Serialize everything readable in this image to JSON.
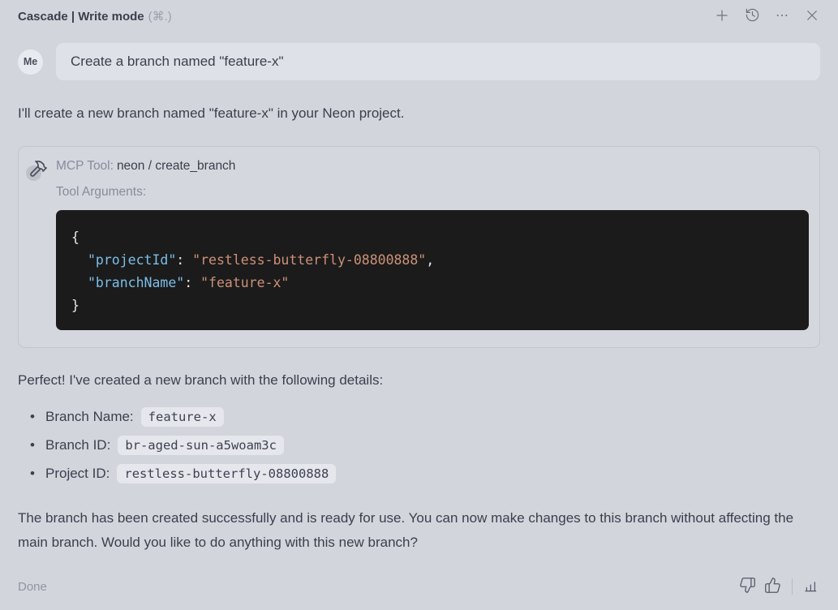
{
  "colors": {
    "page_bg": "#d3d5dd",
    "bubble_bg": "#dfe1e9",
    "avatar_bg": "#e9eaef",
    "text_primary": "#3b404d",
    "text_muted": "#878c9a",
    "box_border": "#c2c5cf",
    "code_bg": "#1b1b1b",
    "code_key": "#7cbee8",
    "code_string": "#ce9178",
    "chip_bg": "#e6e7ed"
  },
  "header": {
    "title": "Cascade | Write mode",
    "shortcut": "(⌘.)",
    "actions": [
      "new-conversation",
      "history",
      "more-options",
      "close"
    ]
  },
  "user_message": {
    "avatar_label": "Me",
    "text": "Create a branch named \"feature-x\""
  },
  "assistant": {
    "intro": "I'll create a new branch named \"feature-x\" in your Neon project.",
    "tool_call": {
      "label": "MCP Tool:",
      "tool_name": "neon / create_branch",
      "arguments_label": "Tool Arguments:",
      "code": {
        "open_brace": "{",
        "line1": {
          "key": "\"projectId\"",
          "sep": ": ",
          "value": "\"restless-butterfly-08800888\"",
          "comma": ","
        },
        "line2": {
          "key": "\"branchName\"",
          "sep": ": ",
          "value": "\"feature-x\""
        },
        "close_brace": "}"
      }
    },
    "result_intro": "Perfect! I've created a new branch with the following details:",
    "details": [
      {
        "label": "Branch Name:",
        "value": "feature-x"
      },
      {
        "label": "Branch ID:",
        "value": "br-aged-sun-a5woam3c"
      },
      {
        "label": "Project ID:",
        "value": "restless-butterfly-08800888"
      }
    ],
    "closing": "The branch has been created successfully and is ready for use. You can now make changes to this branch without affecting the main branch. Would you like to do anything with this new branch?"
  },
  "footer": {
    "status": "Done",
    "actions": [
      "thumbs-down",
      "thumbs-up",
      "usage-stats"
    ]
  }
}
